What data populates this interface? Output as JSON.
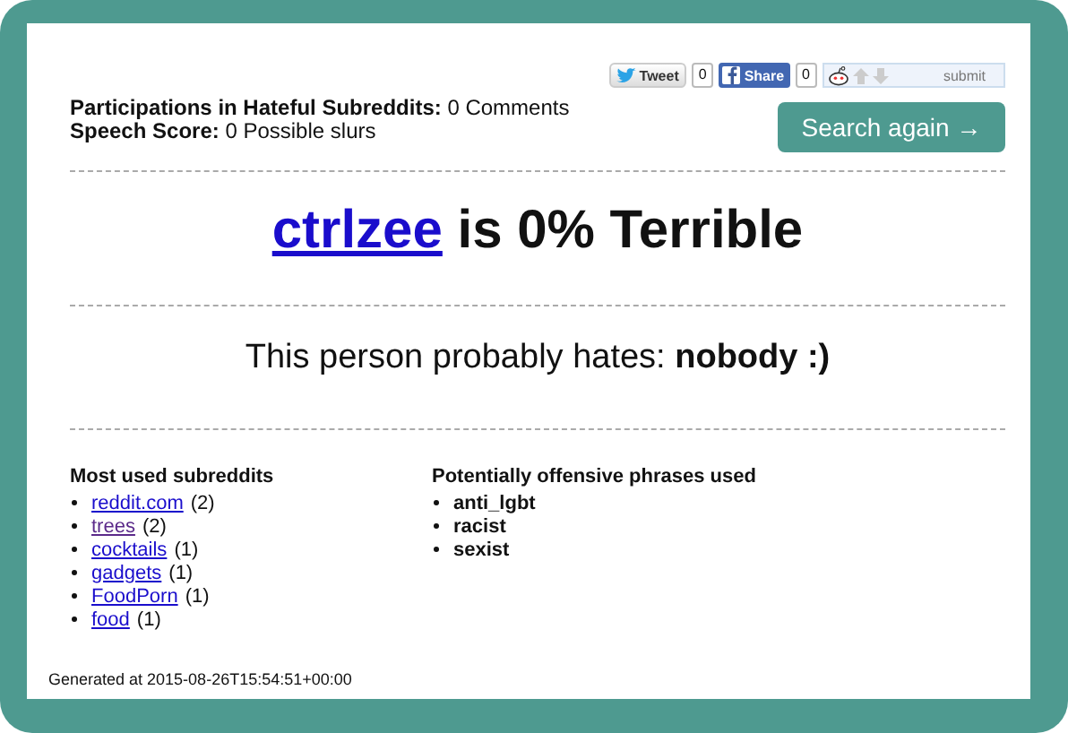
{
  "stats": [
    {
      "label": "Participations in Hateful Subreddits:",
      "value": "0 Comments"
    },
    {
      "label": "Speech Score:",
      "value": "0 Possible slurs"
    }
  ],
  "social": {
    "tweet": "Tweet",
    "tweet_count": "0",
    "share": "Share",
    "share_count": "0",
    "submit": "submit"
  },
  "search_button": "Search again →",
  "headline": {
    "user": "ctrlzee",
    "rest": "is 0% Terrible"
  },
  "hates": {
    "label": "This person probably hates:",
    "value": "nobody :)"
  },
  "subreddits": {
    "title": "Most used subreddits",
    "items": [
      {
        "name": "reddit.com",
        "count": "(2)",
        "visited": false
      },
      {
        "name": "trees",
        "count": "(2)",
        "visited": true
      },
      {
        "name": "cocktails",
        "count": "(1)",
        "visited": false
      },
      {
        "name": "gadgets",
        "count": "(1)",
        "visited": false
      },
      {
        "name": "FoodPorn",
        "count": "(1)",
        "visited": false
      },
      {
        "name": "food",
        "count": "(1)",
        "visited": false
      }
    ]
  },
  "phrases": {
    "title": "Potentially offensive phrases used",
    "items": [
      "anti_lgbt",
      "racist",
      "sexist"
    ]
  },
  "footer": "Generated at 2015-08-26T15:54:51+00:00"
}
